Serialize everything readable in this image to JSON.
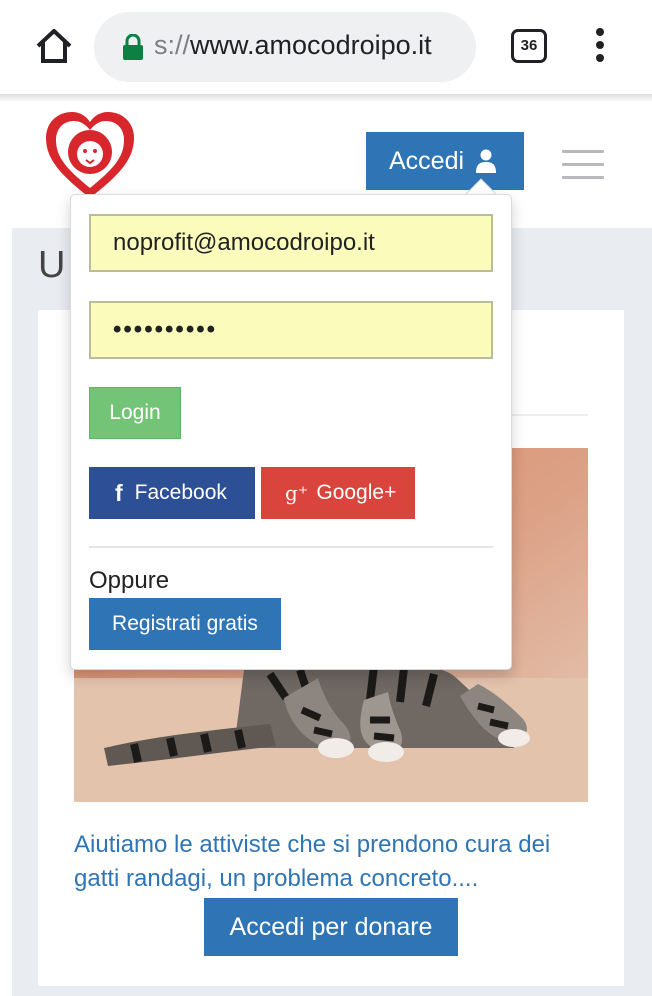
{
  "browser": {
    "url_prefix": "s://",
    "url_domain": "www.amocodroipo.it",
    "tab_count": "36"
  },
  "header": {
    "login_label": "Accedi"
  },
  "page": {
    "heading": "U",
    "card_text": "Aiutiamo le attiviste che si prendono cura dei gatti randagi, un problema concreto....",
    "donate_label": "Accedi per donare"
  },
  "login_dropdown": {
    "email_value": "noprofit@amocodroipo.it",
    "password_value": "••••••••••",
    "login_label": "Login",
    "facebook_label": "Facebook",
    "google_label": "Google+",
    "or_label": "Oppure",
    "register_label": "Registrati gratis"
  },
  "colors": {
    "primary_blue": "#2f75b5",
    "login_green": "#73c477",
    "facebook_blue": "#2d4f96",
    "google_red": "#d9453c",
    "field_yellow": "#fbfcbc",
    "logo_red": "#d8262d"
  },
  "icons": [
    "home-icon",
    "lock-icon",
    "menu-dots-icon",
    "user-icon",
    "hamburger-icon",
    "facebook-icon",
    "google-plus-icon",
    "lion-heart-logo"
  ]
}
